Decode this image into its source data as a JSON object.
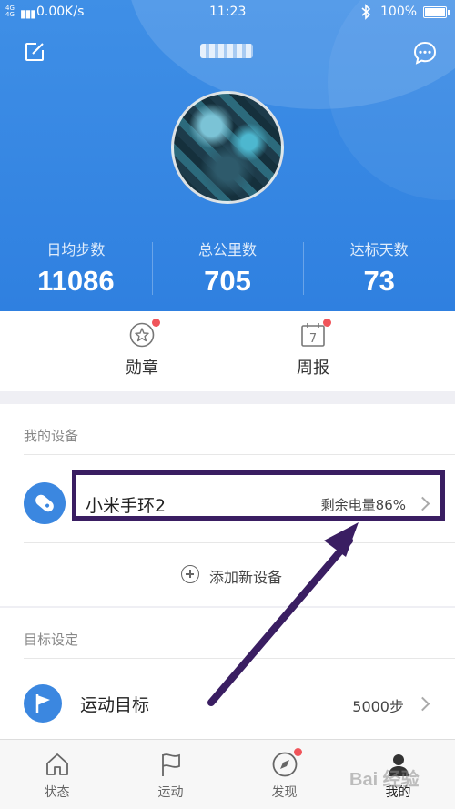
{
  "status_bar": {
    "network": "4G 4G",
    "speed": "0.00K/s",
    "time": "11:23",
    "battery": "100%"
  },
  "header": {
    "stats": [
      {
        "label": "日均步数",
        "value": "11086"
      },
      {
        "label": "总公里数",
        "value": "705"
      },
      {
        "label": "达标天数",
        "value": "73"
      }
    ],
    "colors": {
      "primary": "#2f80e0",
      "accent": "#3b87e0"
    }
  },
  "quick_actions": [
    {
      "label": "勋章",
      "icon": "star-medal-icon",
      "badge": true
    },
    {
      "label": "周报",
      "icon": "calendar-7-icon",
      "day": "7",
      "badge": true
    }
  ],
  "devices": {
    "title": "我的设备",
    "items": [
      {
        "name": "小米手环2",
        "status": "剩余电量86%",
        "icon": "band-icon"
      }
    ],
    "add_label": "添加新设备"
  },
  "goals": {
    "title": "目标设定",
    "items": [
      {
        "name": "运动目标",
        "value": "5000步",
        "icon": "flag-icon"
      }
    ]
  },
  "bottom_nav": [
    {
      "label": "状态",
      "icon": "home-icon"
    },
    {
      "label": "运动",
      "icon": "flag-outline-icon"
    },
    {
      "label": "发现",
      "icon": "compass-icon",
      "badge": true
    },
    {
      "label": "我的",
      "icon": "user-icon",
      "active": true
    }
  ],
  "watermark": "Bai 经验"
}
